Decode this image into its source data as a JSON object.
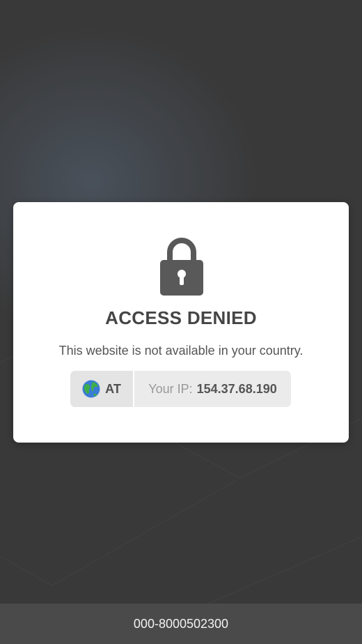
{
  "card": {
    "icon": "lock-icon",
    "title": "ACCESS DENIED",
    "message": "This website is not available in your country."
  },
  "ip_info": {
    "country_icon": "globe-icon",
    "country_code": "AT",
    "ip_label": "Your IP:",
    "ip_value": "154.37.68.190"
  },
  "footer": {
    "reference": "000-8000502300"
  },
  "colors": {
    "background": "#393939",
    "card": "#ffffff",
    "title": "#454545",
    "footer": "#4a4a4a"
  }
}
